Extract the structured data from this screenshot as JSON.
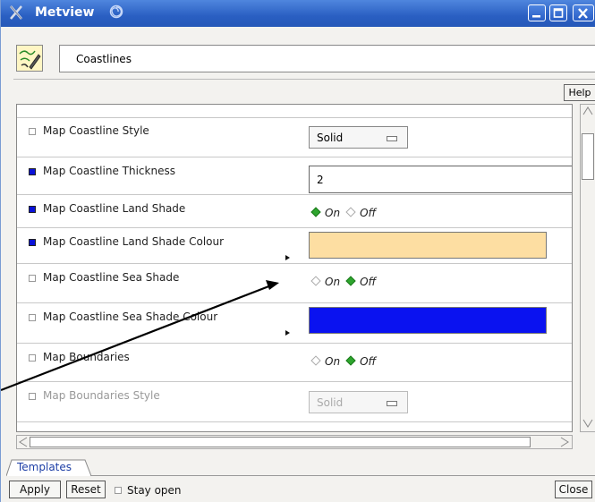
{
  "window": {
    "title": "Metview",
    "buttons": [
      "minimize-icon",
      "maximize-icon",
      "close-icon"
    ]
  },
  "icon_name_field": {
    "value": "Coastlines"
  },
  "help_label": "Help",
  "rows": [
    {
      "label": "Map Coastline Style",
      "checked": false,
      "control": "option",
      "value": "Solid"
    },
    {
      "label": "Map Coastline Thickness",
      "checked": true,
      "control": "text",
      "value": "2"
    },
    {
      "label": "Map Coastline Land Shade",
      "checked": true,
      "control": "radio",
      "on_label": "On",
      "off_label": "Off",
      "selected": "On"
    },
    {
      "label": "Map Coastline Land Shade Colour",
      "checked": true,
      "control": "colour",
      "colour": "#fddea2"
    },
    {
      "label": "Map Coastline Sea Shade",
      "checked": false,
      "control": "radio",
      "on_label": "On",
      "off_label": "Off",
      "selected": "Off"
    },
    {
      "label": "Map Coastline Sea Shade Colour",
      "checked": false,
      "control": "colour",
      "colour": "#0a12f0"
    },
    {
      "label": "Map Boundaries",
      "checked": false,
      "control": "radio",
      "on_label": "On",
      "off_label": "Off",
      "selected": "Off"
    },
    {
      "label": "Map Boundaries Style",
      "checked": false,
      "control": "option",
      "value": "Solid",
      "disabled": true
    }
  ],
  "tabs": {
    "templates": "Templates"
  },
  "footer": {
    "apply": "Apply",
    "reset": "Reset",
    "stay_open": "Stay open",
    "close": "Close"
  },
  "colors": {
    "titlebar": "#2a5fc2",
    "checkbox_on": "#0a12d8",
    "radio_selected": "#2ea52e"
  }
}
